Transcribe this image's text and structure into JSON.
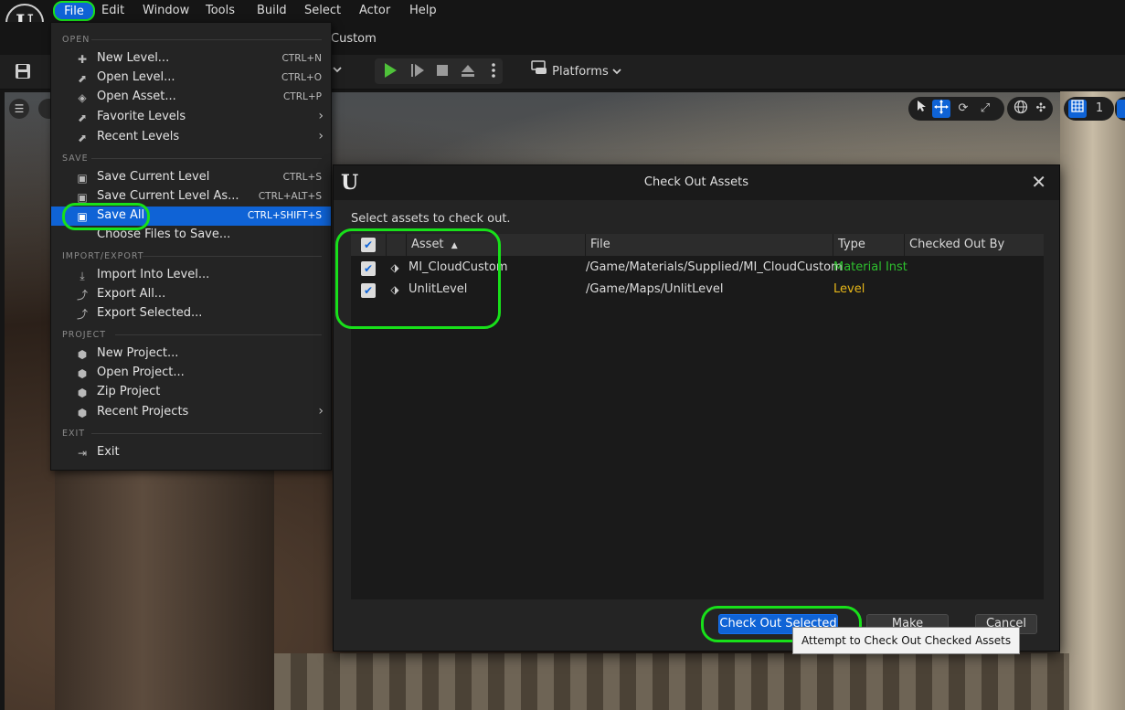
{
  "menubar": {
    "logo": "U",
    "items": [
      "File",
      "Edit",
      "Window",
      "Tools",
      "Build",
      "Select",
      "Actor",
      "Help"
    ]
  },
  "level_tab": "Custom",
  "toolbar": {
    "platforms_label": "Platforms"
  },
  "viewport": {
    "grid_size": "1"
  },
  "file_menu": {
    "sections": {
      "open": "OPEN",
      "save": "SAVE",
      "import_export": "IMPORT/EXPORT",
      "project": "PROJECT",
      "exit": "EXIT"
    },
    "items": [
      {
        "label": "New Level...",
        "shortcut": "CTRL+N",
        "icon": "new-level-icon"
      },
      {
        "label": "Open Level...",
        "shortcut": "CTRL+O",
        "icon": "open-level-icon"
      },
      {
        "label": "Open Asset...",
        "shortcut": "CTRL+P",
        "icon": "open-asset-icon"
      },
      {
        "label": "Favorite Levels",
        "shortcut": "",
        "icon": "favorite-levels-icon"
      },
      {
        "label": "Recent Levels",
        "shortcut": "",
        "icon": "recent-levels-icon"
      },
      {
        "label": "Save Current Level",
        "shortcut": "CTRL+S",
        "icon": "save-icon"
      },
      {
        "label": "Save Current Level As...",
        "shortcut": "CTRL+ALT+S",
        "icon": "save-as-icon"
      },
      {
        "label": "Save All",
        "shortcut": "CTRL+SHIFT+S",
        "icon": "save-all-icon"
      },
      {
        "label": "Choose Files to Save...",
        "shortcut": "",
        "icon": ""
      },
      {
        "label": "Import Into Level...",
        "shortcut": "",
        "icon": "import-icon"
      },
      {
        "label": "Export All...",
        "shortcut": "",
        "icon": "export-icon"
      },
      {
        "label": "Export Selected...",
        "shortcut": "",
        "icon": "export-selected-icon"
      },
      {
        "label": "New Project...",
        "shortcut": "",
        "icon": "new-project-icon"
      },
      {
        "label": "Open Project...",
        "shortcut": "",
        "icon": "open-project-icon"
      },
      {
        "label": "Zip Project",
        "shortcut": "",
        "icon": "zip-project-icon"
      },
      {
        "label": "Recent Projects",
        "shortcut": "",
        "icon": "recent-projects-icon"
      },
      {
        "label": "Exit",
        "shortcut": "",
        "icon": "exit-icon"
      }
    ]
  },
  "dialog": {
    "title": "Check Out Assets",
    "prompt": "Select assets to check out.",
    "columns": [
      "Asset",
      "File",
      "Type",
      "Checked Out By"
    ],
    "rows": [
      {
        "asset": "MI_CloudCustom",
        "file": "/Game/Materials/Supplied/MI_CloudCustom",
        "type": "Material Inst",
        "type_color": "#2ec02e",
        "checked_out_by": "",
        "checked": true
      },
      {
        "asset": "UnlitLevel",
        "file": "/Game/Maps/UnlitLevel",
        "type": "Level",
        "type_color": "#e6b619",
        "checked_out_by": "",
        "checked": true
      }
    ],
    "buttons": {
      "checkout": "Check Out Selected",
      "writable": "Make Writable",
      "cancel": "Cancel"
    },
    "tooltip": "Attempt to Check Out Checked Assets"
  },
  "colors": {
    "accent": "#0f63d6",
    "highlight_ring": "#18e01a"
  }
}
